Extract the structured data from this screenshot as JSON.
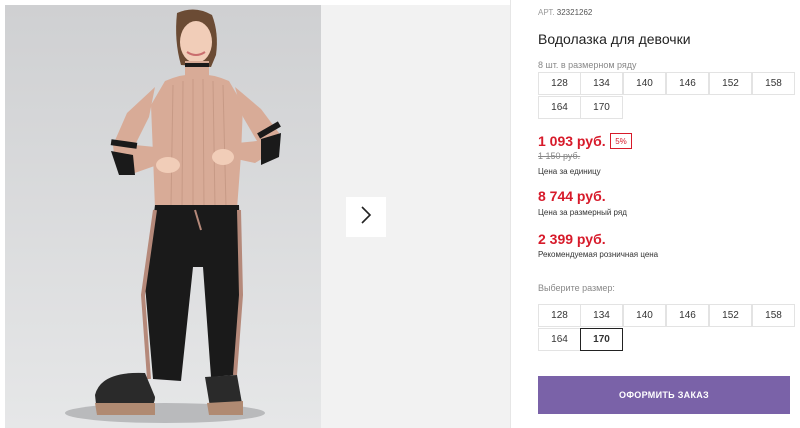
{
  "product": {
    "article_label": "АРТ.",
    "article_number": "32321262",
    "title": "Водолазка для девочки"
  },
  "size_set": {
    "caption": "8 шт. в размерном ряду",
    "sizes": [
      "128",
      "134",
      "140",
      "146",
      "152",
      "158",
      "164",
      "170"
    ]
  },
  "pricing": {
    "unit_price": "1 093 руб.",
    "discount": "5%",
    "old_price": "1 150 руб.",
    "unit_label": "Цена за единицу",
    "set_price": "8 744 руб.",
    "set_label": "Цена за размерный ряд",
    "retail_price": "2 399 руб.",
    "retail_label": "Рекомендуемая розничная цена"
  },
  "size_picker": {
    "caption": "Выберите размер:",
    "sizes": [
      "128",
      "134",
      "140",
      "146",
      "152",
      "158",
      "164",
      "170"
    ],
    "selected": "170"
  },
  "actions": {
    "order_label": "ОФОРМИТЬ ЗАКАЗ"
  },
  "colors": {
    "price_red": "#d71a2a",
    "button_purple": "#7a62a8",
    "sweater": "#d8ab97",
    "pants": "#1a1a1a"
  },
  "icons": {
    "next": "chevron-right-icon"
  }
}
